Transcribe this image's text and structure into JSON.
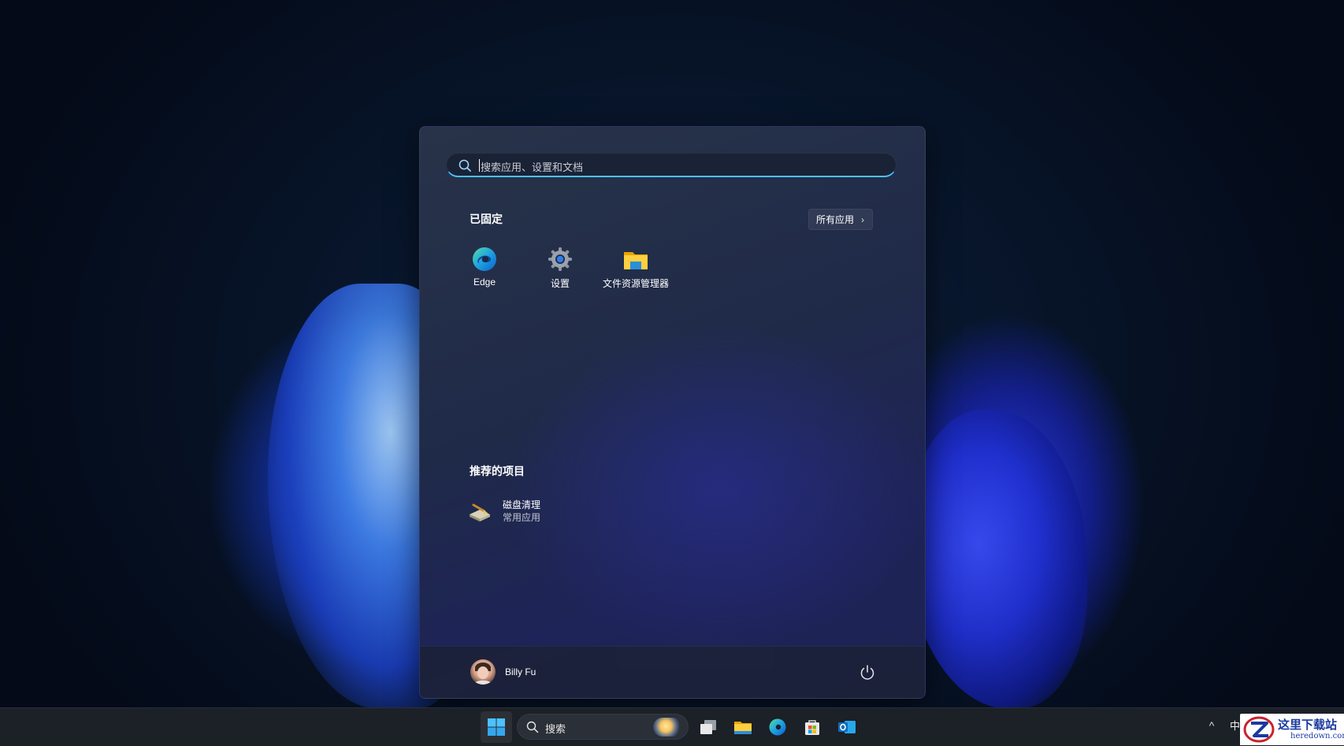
{
  "start_menu": {
    "search_placeholder": "搜索应用、设置和文档",
    "pinned_title": "已固定",
    "all_apps_label": "所有应用",
    "pinned_apps": [
      {
        "label": "Edge",
        "icon": "edge-icon"
      },
      {
        "label": "设置",
        "icon": "settings-gear-icon"
      },
      {
        "label": "文件资源管理器",
        "icon": "file-explorer-folder-icon"
      }
    ],
    "recommended_title": "推荐的项目",
    "recommended": [
      {
        "name": "磁盘清理",
        "subtitle": "常用应用",
        "icon": "disk-cleanup-icon"
      }
    ],
    "user_name": "Billy Fu",
    "power_icon": "power-icon"
  },
  "taskbar": {
    "search_label": "搜索",
    "tray_ime": "中",
    "accent_color": "#4cc2ff"
  },
  "watermark": {
    "title": "这里下载站",
    "url": "heredown.com"
  }
}
